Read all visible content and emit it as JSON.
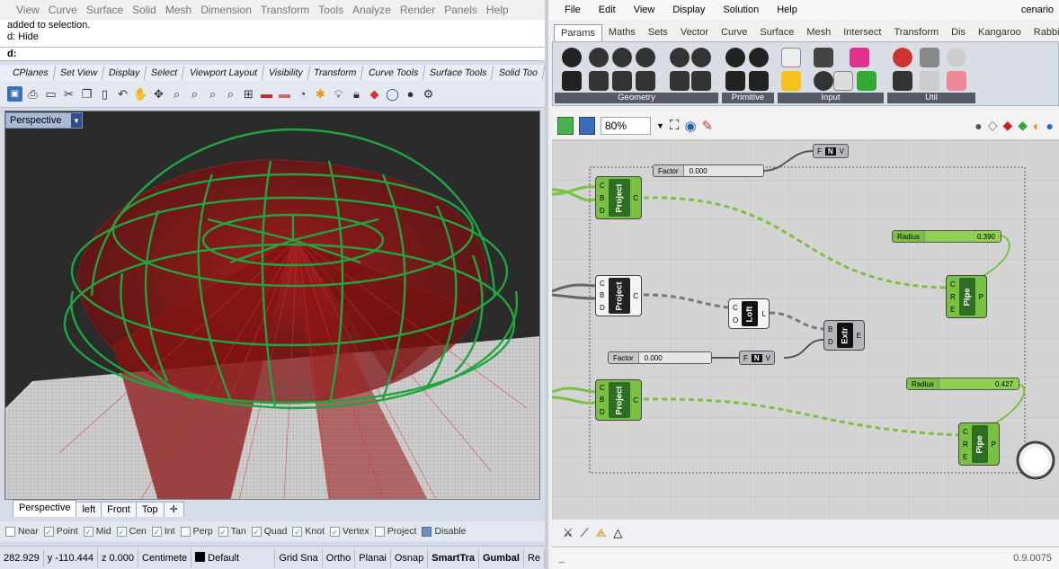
{
  "rhino": {
    "menu": [
      "View",
      "Curve",
      "Surface",
      "Solid",
      "Mesh",
      "Dimension",
      "Transform",
      "Tools",
      "Analyze",
      "Render",
      "Panels",
      "Help"
    ],
    "history_line1": "added to selection.",
    "history_line2": "d: Hide",
    "command_prompt": "d:",
    "toolbar_tabs": [
      "CPlanes",
      "Set View",
      "Display",
      "Select",
      "Viewport Layout",
      "Visibility",
      "Transform",
      "Curve Tools",
      "Surface Tools",
      "Solid Too"
    ],
    "viewport_title": "Perspective",
    "view_tabs": [
      "Perspective",
      "left",
      "Front",
      "Top"
    ],
    "osnaps": [
      {
        "label": "Near",
        "checked": false
      },
      {
        "label": "Point",
        "checked": true
      },
      {
        "label": "Mid",
        "checked": true
      },
      {
        "label": "Cen",
        "checked": true
      },
      {
        "label": "Int",
        "checked": true
      },
      {
        "label": "Perp",
        "checked": false
      },
      {
        "label": "Tan",
        "checked": true
      },
      {
        "label": "Quad",
        "checked": true
      },
      {
        "label": "Knot",
        "checked": true
      },
      {
        "label": "Vertex",
        "checked": true
      },
      {
        "label": "Project",
        "checked": false
      },
      {
        "label": "Disable",
        "checked": true
      }
    ],
    "status": {
      "x": "282.929",
      "y": "y -110.444",
      "z": "z 0.000",
      "units": "Centimete",
      "layer": "Default",
      "grid_snap": "Grid Sna",
      "ortho": "Ortho",
      "planar": "Planai",
      "osnap": "Osnap",
      "smarttrack": "SmartTra",
      "gumball": "Gumbal",
      "record": "Re"
    }
  },
  "gh": {
    "menu": [
      "File",
      "Edit",
      "View",
      "Display",
      "Solution",
      "Help"
    ],
    "doc_name": "cenario",
    "tabs": [
      "Params",
      "Maths",
      "Sets",
      "Vector",
      "Curve",
      "Surface",
      "Mesh",
      "Intersect",
      "Transform",
      "Dis",
      "Kangaroo",
      "Rabbit"
    ],
    "active_tab": "Params",
    "ribbon_groups": [
      "Geometry",
      "Primitive",
      "Input",
      "Util"
    ],
    "zoom": "80%",
    "components": {
      "project": "Project",
      "loft": "Loft",
      "extr": "Extr",
      "pipe": "Pipe"
    },
    "sliders": {
      "factor1": {
        "label": "Factor",
        "value": "0.000"
      },
      "factor2": {
        "label": "Factor",
        "value": "0.000"
      },
      "radius1": {
        "label": "Radius",
        "value": "0.390"
      },
      "radius2": {
        "label": "Radius",
        "value": "0.427"
      }
    },
    "fzv": {
      "f": "F",
      "z": "N",
      "v": "V"
    },
    "version": "0.9.0075",
    "status_left": "_"
  },
  "colors": {
    "gh_component_green": "#7ac143",
    "rhino_wire_green": "#19a23a",
    "rhino_surface_red": "#a11212"
  }
}
